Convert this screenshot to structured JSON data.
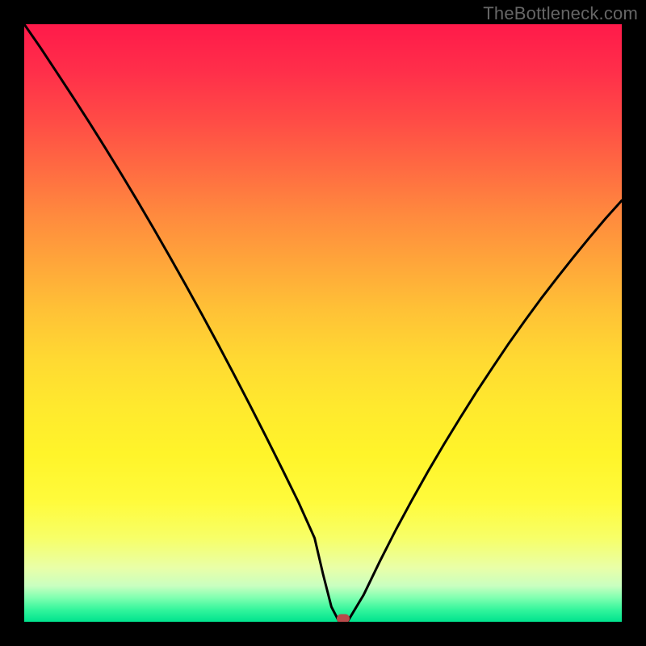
{
  "watermark": "TheBottleneck.com",
  "chart_data": {
    "type": "line",
    "title": "",
    "xlabel": "",
    "ylabel": "",
    "xlim": [
      0,
      100
    ],
    "ylim": [
      0,
      100
    ],
    "axes_visible": false,
    "grid": false,
    "background_gradient": {
      "direction": "vertical",
      "stops": [
        {
          "pos": 0.0,
          "color": "#ff1a4a",
          "meaning": "red"
        },
        {
          "pos": 0.5,
          "color": "#ffc236",
          "meaning": "orange"
        },
        {
          "pos": 0.8,
          "color": "#fffb3c",
          "meaning": "yellow"
        },
        {
          "pos": 1.0,
          "color": "#00e38e",
          "meaning": "green"
        }
      ]
    },
    "series": [
      {
        "name": "bottleneck-curve",
        "color": "#000000",
        "stroke_width": 3,
        "x": [
          0.0,
          2.7,
          5.4,
          8.1,
          10.8,
          13.5,
          16.2,
          18.9,
          21.6,
          24.3,
          27.0,
          29.7,
          32.4,
          35.1,
          37.8,
          40.5,
          43.2,
          45.9,
          48.6,
          50.0,
          51.4,
          52.7,
          54.1,
          56.8,
          59.5,
          62.2,
          64.9,
          67.6,
          70.3,
          73.0,
          75.7,
          78.4,
          81.1,
          83.8,
          86.5,
          89.2,
          91.9,
          94.6,
          97.3,
          100.0
        ],
        "y": [
          100.0,
          96.1,
          92.0,
          87.9,
          83.7,
          79.4,
          75.0,
          70.5,
          65.9,
          61.2,
          56.4,
          51.5,
          46.5,
          41.4,
          36.2,
          30.9,
          25.5,
          20.0,
          14.0,
          8.0,
          2.5,
          0.0,
          0.0,
          4.5,
          10.1,
          15.4,
          20.4,
          25.2,
          29.8,
          34.2,
          38.5,
          42.6,
          46.6,
          50.4,
          54.1,
          57.6,
          61.0,
          64.3,
          67.5,
          70.5
        ]
      }
    ],
    "marker": {
      "name": "optimal-point",
      "x": 53.4,
      "y": 0.5,
      "color": "#b84a4a",
      "shape": "rounded-rect"
    }
  }
}
